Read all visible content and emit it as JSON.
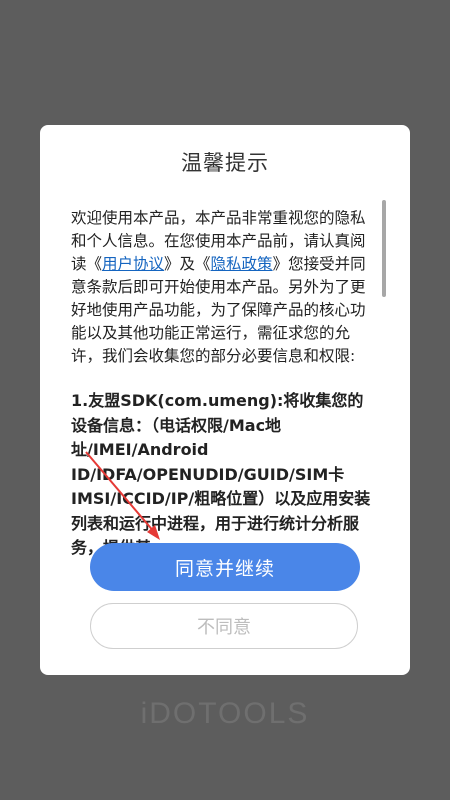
{
  "dialog": {
    "title": "温馨提示",
    "intro": {
      "before_link1": "欢迎使用本产品，本产品非常重视您的隐私和个人信息。在您使用本产品前，请认真阅读《",
      "link1": "用户协议",
      "between_links": "》及《",
      "link2": "隐私政策",
      "after_link2": "》您接受并同意条款后即可开始使用本产品。另外为了更好地使用产品功能，为了保障产品的核心功能以及其他功能正常运行，需征求您的允许，我们会收集您的部分必要信息和权限:"
    },
    "sdk_item": "1.友盟SDK(com.umeng):将收集您的设备信息：（电话权限/Mac地址/IMEI/Android ID/IDFA/OPENUDID/GUID/SIM卡IMSI/ICCID/IP/粗略位置）以及应用安装列表和运行中进程，用于进行统计分析服务，提供基",
    "agree_button": "同意并继续",
    "disagree_button": "不同意"
  },
  "brand": {
    "logo_text": "iDOTOOLS"
  },
  "colors": {
    "accent": "#4a86e8",
    "overlay": "#5d5d5d",
    "link": "#1565c0",
    "arrow": "#e53935"
  },
  "scrollbar": {
    "visible_fraction": 0.22,
    "position_fraction": 0
  }
}
